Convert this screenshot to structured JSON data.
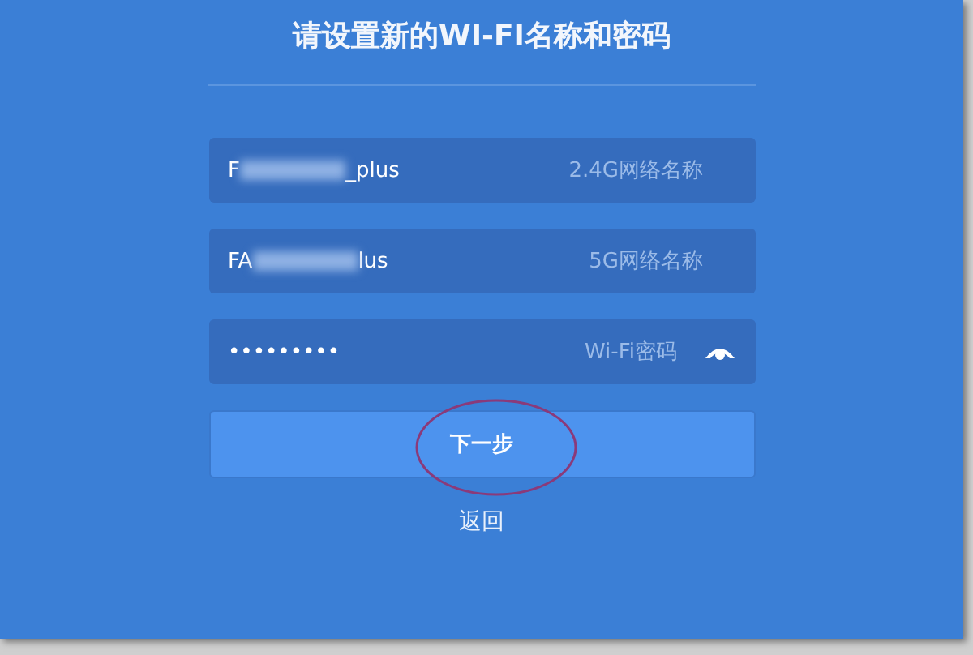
{
  "title": "请设置新的WI-FI名称和密码",
  "fields": [
    {
      "kind": "text",
      "value_start": "F",
      "value_end": "_plus",
      "redacted": true,
      "label": "2.4G网络名称"
    },
    {
      "kind": "text",
      "value_start": "FA",
      "value_end": "lus",
      "redacted": true,
      "label": "5G网络名称"
    },
    {
      "kind": "password",
      "value_start": "•••••••••",
      "redacted": false,
      "label": "Wi-Fi密码"
    }
  ],
  "next_button": {
    "label": "下一步",
    "circled": true
  },
  "back_link": "返回"
}
